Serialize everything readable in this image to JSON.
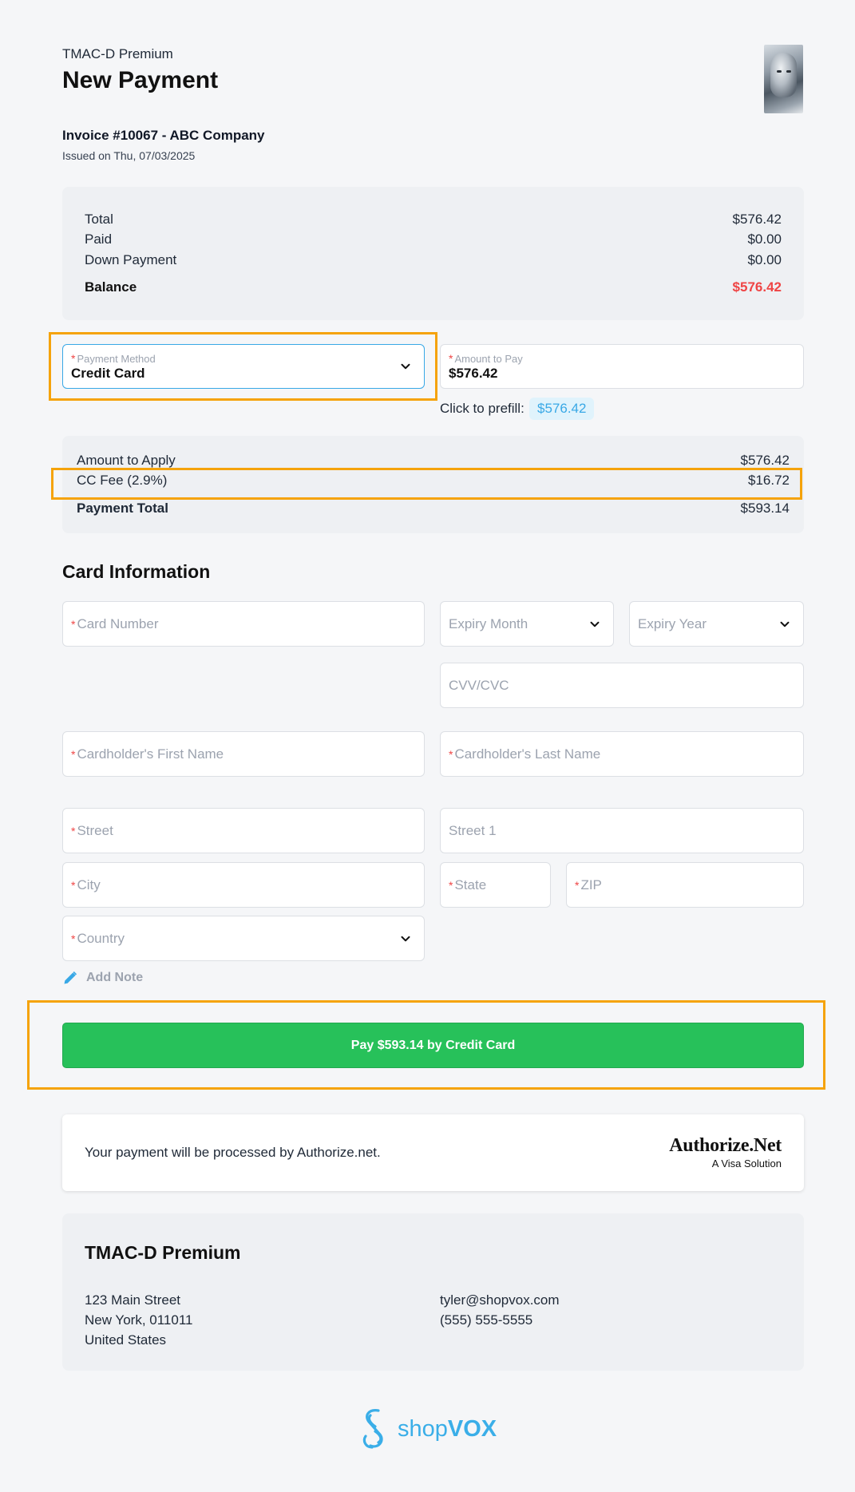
{
  "header": {
    "company": "TMAC-D Premium",
    "title": "New Payment",
    "invoice": "Invoice #10067 - ABC Company",
    "issued": "Issued on Thu, 07/03/2025"
  },
  "summary": {
    "total_label": "Total",
    "total_value": "$576.42",
    "paid_label": "Paid",
    "paid_value": "$0.00",
    "down_label": "Down Payment",
    "down_value": "$0.00",
    "balance_label": "Balance",
    "balance_value": "$576.42",
    "balance_color": "#ef4444"
  },
  "payment": {
    "method_label": "Payment Method",
    "method_value": "Credit Card",
    "amount_label": "Amount to Pay",
    "amount_value": "$576.42",
    "prefill_label": "Click to prefill:",
    "prefill_value": "$576.42"
  },
  "apply": {
    "amount_label": "Amount to Apply",
    "amount_value": "$576.42",
    "fee_label": "CC Fee (2.9%)",
    "fee_value": "$16.72",
    "total_label": "Payment Total",
    "total_value": "$593.14"
  },
  "card": {
    "section_title": "Card Information",
    "card_number": "Card Number",
    "expiry_month": "Expiry Month",
    "expiry_year": "Expiry Year",
    "cvv": "CVV/CVC",
    "first_name": "Cardholder's First Name",
    "last_name": "Cardholder's Last Name",
    "street": "Street",
    "street1": "Street 1",
    "city": "City",
    "state": "State",
    "zip": "ZIP",
    "country": "Country"
  },
  "add_note": "Add Note",
  "pay_button": "Pay $593.14 by Credit Card",
  "pay_button_color": "#27c15a",
  "processor": {
    "text": "Your payment will be processed by Authorize.net.",
    "logo_main": "Authorize.Net",
    "logo_sub": "A Visa Solution"
  },
  "footer": {
    "company": "TMAC-D Premium",
    "address1": "123 Main Street",
    "address2": "New York, 011011",
    "address3": "United States",
    "email": "tyler@shopvox.com",
    "phone": "(555) 555-5555"
  },
  "brand": {
    "shop": "shop",
    "vox": "VOX",
    "color": "#3aaee8"
  },
  "highlight_color": "#f5a30b",
  "icons": [
    "chevron-down-icon",
    "pencil-icon",
    "shopvox-logo-icon"
  ]
}
